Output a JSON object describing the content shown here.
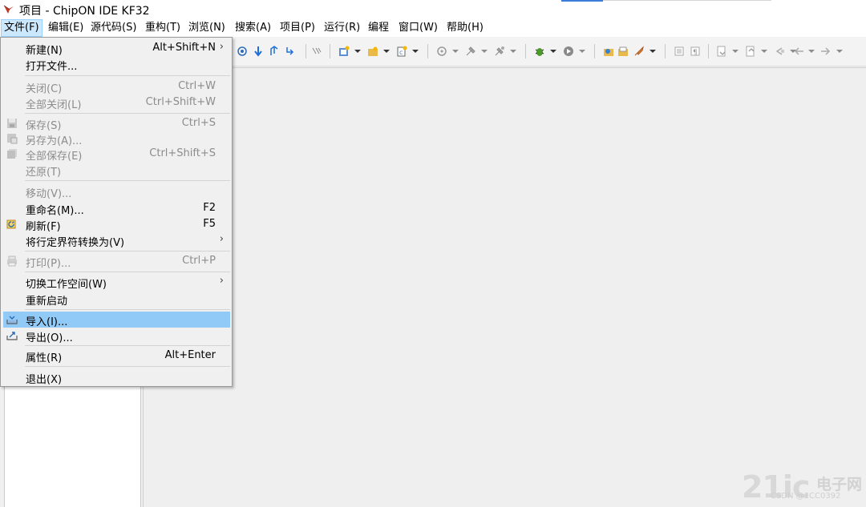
{
  "window": {
    "title": "项目 - ChipON IDE KF32"
  },
  "menubar": {
    "items": [
      {
        "label": "文件(F)"
      },
      {
        "label": "编辑(E)"
      },
      {
        "label": "源代码(S)"
      },
      {
        "label": "重构(T)"
      },
      {
        "label": "浏览(N)"
      },
      {
        "label": "搜索(A)"
      },
      {
        "label": "项目(P)"
      },
      {
        "label": "运行(R)"
      },
      {
        "label": "编程"
      },
      {
        "label": "窗口(W)"
      },
      {
        "label": "帮助(H)"
      }
    ],
    "active": "文件(F)"
  },
  "file_menu": {
    "items": [
      {
        "label": "新建(N)",
        "shortcut": "Alt+Shift+N",
        "submenu": "›",
        "enabled": true
      },
      {
        "label": "打开文件...",
        "enabled": true
      },
      {
        "label": "关闭(C)",
        "shortcut": "Ctrl+W",
        "enabled": false
      },
      {
        "label": "全部关闭(L)",
        "shortcut": "Ctrl+Shift+W",
        "enabled": false
      },
      {
        "label": "保存(S)",
        "shortcut": "Ctrl+S",
        "enabled": false,
        "icon": "save-icon"
      },
      {
        "label": "另存为(A)...",
        "enabled": false,
        "icon": "save-as-icon"
      },
      {
        "label": "全部保存(E)",
        "shortcut": "Ctrl+Shift+S",
        "enabled": false,
        "icon": "save-all-icon"
      },
      {
        "label": "还原(T)",
        "enabled": false
      },
      {
        "label": "移动(V)...",
        "enabled": false
      },
      {
        "label": "重命名(M)...",
        "shortcut": "F2",
        "enabled": true
      },
      {
        "label": "刷新(F)",
        "shortcut": "F5",
        "enabled": true,
        "icon": "refresh-icon"
      },
      {
        "label": "将行定界符转换为(V)",
        "submenu": "›",
        "enabled": true
      },
      {
        "label": "打印(P)...",
        "shortcut": "Ctrl+P",
        "enabled": false,
        "icon": "print-icon"
      },
      {
        "label": "切换工作空间(W)",
        "submenu": "›",
        "enabled": true
      },
      {
        "label": "重新启动",
        "enabled": true
      },
      {
        "label": "导入(I)...",
        "enabled": true,
        "highlighted": true,
        "icon": "import-icon"
      },
      {
        "label": "导出(O)...",
        "enabled": true,
        "icon": "export-icon"
      },
      {
        "label": "属性(R)",
        "shortcut": "Alt+Enter",
        "enabled": true
      },
      {
        "label": "退出(X)",
        "enabled": true
      }
    ]
  },
  "colors": {
    "menu_highlight": "#91c9f7",
    "active_menu": "#cce8ff",
    "disabled_text": "#8c8c8c"
  },
  "watermark": {
    "logo": "21ic",
    "text": "电子网",
    "small": "CSDN @1CC0392"
  }
}
